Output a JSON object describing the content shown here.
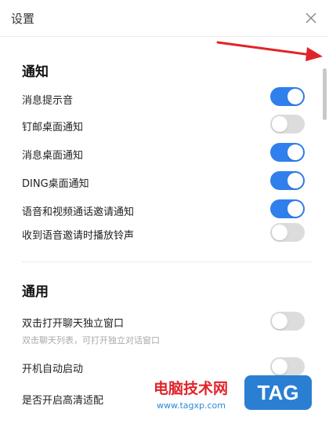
{
  "window": {
    "title": "设置"
  },
  "sections": [
    {
      "title": "通知",
      "items": [
        {
          "label": "消息提示音",
          "on": true
        },
        {
          "label": "钉邮桌面通知",
          "on": false
        },
        {
          "label": "消息桌面通知",
          "on": true
        },
        {
          "label": "DING桌面通知",
          "on": true
        },
        {
          "label": "语音和视频通话邀请通知",
          "on": true
        },
        {
          "label": "收到语音邀请时播放铃声",
          "on": false
        }
      ]
    },
    {
      "title": "通用",
      "items": [
        {
          "label": "双击打开聊天独立窗口",
          "sub": "双击聊天列表，可打开独立对话窗口",
          "on": false
        },
        {
          "label": "开机自动启动",
          "on": false
        },
        {
          "label": "是否开启高清适配",
          "on": false
        }
      ]
    }
  ],
  "watermark": {
    "text": "电脑技术网",
    "url": "www.tagxp.com",
    "tag": "TAG"
  },
  "colors": {
    "toggle_on": "#2f80ed",
    "toggle_off": "#dcdcdc",
    "arrow": "#e0242a"
  }
}
